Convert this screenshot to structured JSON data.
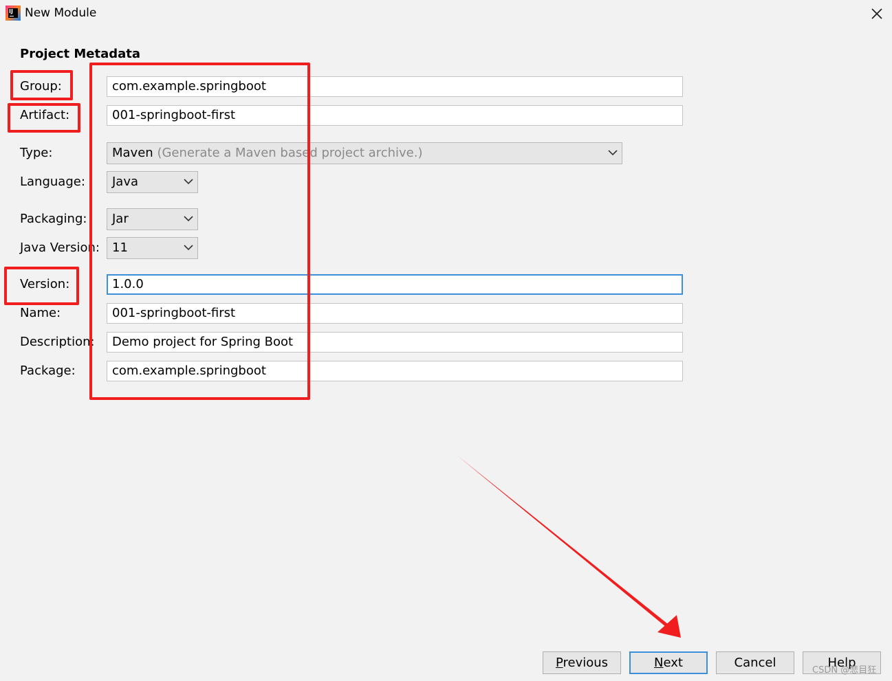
{
  "window": {
    "title": "New Module",
    "app_icon": "intellij-idea-icon",
    "app_icon_text": "IJ"
  },
  "section_title": "Project Metadata",
  "fields": {
    "group": {
      "label": "Group:",
      "value": "com.example.springboot"
    },
    "artifact": {
      "label": "Artifact:",
      "value": "001-springboot-first"
    },
    "type": {
      "label": "Type:",
      "value": "Maven",
      "hint": "(Generate a Maven based project archive.)"
    },
    "language": {
      "label": "Language:",
      "value": "Java"
    },
    "packaging": {
      "label": "Packaging:",
      "value": "Jar"
    },
    "java_version": {
      "label": "Java Version:",
      "value": "11"
    },
    "version": {
      "label": "Version:",
      "value": "1.0.0"
    },
    "name": {
      "label": "Name:",
      "value": "001-springboot-first"
    },
    "description": {
      "label": "Description:",
      "value": "Demo project for Spring Boot"
    },
    "package": {
      "label": "Package:",
      "value": "com.example.springboot"
    }
  },
  "buttons": {
    "previous": {
      "mnemonic": "P",
      "rest": "revious"
    },
    "next": {
      "mnemonic": "N",
      "rest": "ext"
    },
    "cancel": {
      "label": "Cancel"
    },
    "help": {
      "label": "Help"
    }
  },
  "watermark": "CSDN @悲目狂",
  "colors": {
    "annotation": "#f01e1e",
    "focus": "#3d8fd9",
    "background": "#f2f2f2"
  }
}
